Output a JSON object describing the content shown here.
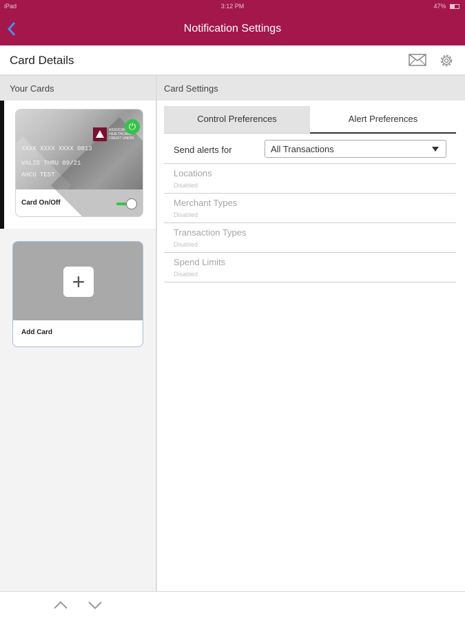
{
  "status_bar": {
    "device": "iPad",
    "time": "3:12 PM",
    "battery": "47%"
  },
  "nav": {
    "back_icon": "chevron-left-icon",
    "title": "Notification Settings"
  },
  "header": {
    "title": "Card Details",
    "icons": [
      "mail-icon",
      "gear-icon"
    ]
  },
  "left_panel": {
    "title": "Your Cards",
    "card": {
      "number": "XXXX XXXX XXXX 0013",
      "valid": "VALID THRU 09/21",
      "holder": "AHCU TEST",
      "issuer_logo_text": "ASSOCIATED HEALTHCARE CREDIT UNION",
      "toggle_label": "Card On/Off",
      "toggle_on": true
    },
    "add_card_label": "Add Card"
  },
  "right_panel": {
    "title": "Card Settings",
    "tabs": [
      {
        "label": "Control Preferences",
        "active": false
      },
      {
        "label": "Alert Preferences",
        "active": true
      }
    ],
    "send_alerts": {
      "label": "Send alerts for",
      "value": "All Transactions"
    },
    "options": [
      {
        "name": "Locations",
        "status": "Disabled"
      },
      {
        "name": "Merchant Types",
        "status": "Disabled"
      },
      {
        "name": "Transaction Types",
        "status": "Disabled"
      },
      {
        "name": "Spend Limits",
        "status": "Disabled"
      }
    ]
  },
  "colors": {
    "brand": "#a3174b",
    "accent_green": "#35c24a",
    "back_blue": "#4a8ef0"
  }
}
